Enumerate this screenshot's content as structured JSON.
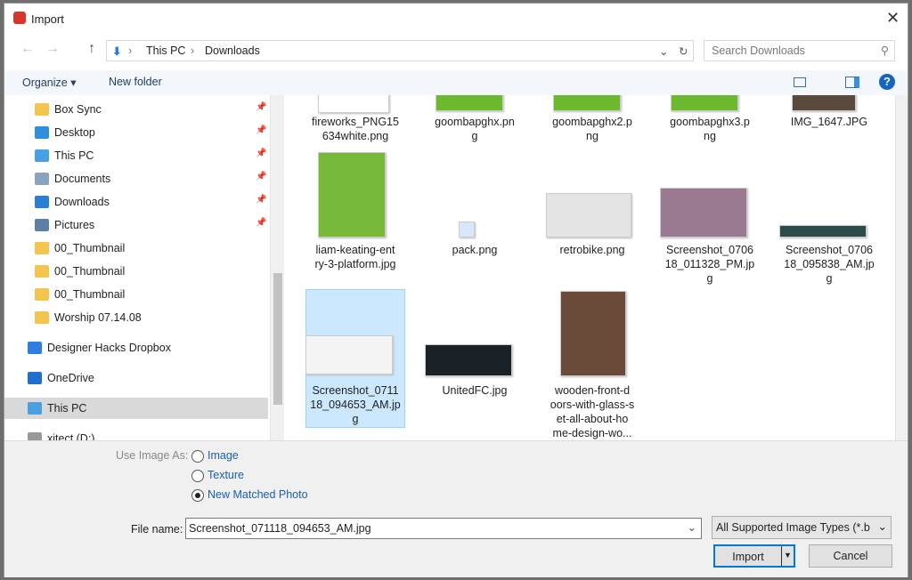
{
  "window": {
    "title": "Import",
    "close": "✕"
  },
  "address": {
    "back": "←",
    "forward": "→",
    "up": "↑",
    "path": [
      "This PC",
      "Downloads"
    ],
    "search_placeholder": "Search Downloads"
  },
  "toolbar": {
    "organize": "Organize ▾",
    "new_folder": "New folder",
    "help": "?"
  },
  "sidebar": {
    "items": [
      {
        "label": "Box Sync",
        "icon": "folder-icon",
        "color": "#f3c44e",
        "pinned": true
      },
      {
        "label": "Desktop",
        "icon": "desktop-icon",
        "color": "#2f8fdc",
        "pinned": true
      },
      {
        "label": "This PC",
        "icon": "computer-icon",
        "color": "#4a9fe0",
        "pinned": true
      },
      {
        "label": "Documents",
        "icon": "documents-icon",
        "color": "#8aa4c0",
        "pinned": true
      },
      {
        "label": "Downloads",
        "icon": "download-icon",
        "color": "#2a7fd4",
        "pinned": true
      },
      {
        "label": "Pictures",
        "icon": "pictures-icon",
        "color": "#5d7fa3",
        "pinned": true
      },
      {
        "label": "00_Thumbnail",
        "icon": "folder-icon",
        "color": "#f3c44e"
      },
      {
        "label": "00_Thumbnail",
        "icon": "folder-icon",
        "color": "#f3c44e"
      },
      {
        "label": "00_Thumbnail",
        "icon": "folder-icon",
        "color": "#f3c44e"
      },
      {
        "label": "Worship 07.14.08",
        "icon": "folder-icon",
        "color": "#f3c44e"
      },
      {
        "label": "Designer Hacks Dropbox",
        "icon": "dropbox-icon",
        "color": "#2f7de0"
      },
      {
        "label": "OneDrive",
        "icon": "onedrive-icon",
        "color": "#1f6fd0"
      },
      {
        "label": "This PC",
        "icon": "computer-icon",
        "color": "#4a9fe0",
        "selected": true
      },
      {
        "label": "xitect (D:)",
        "icon": "drive-icon",
        "color": "#999"
      }
    ]
  },
  "files": [
    {
      "name": "fireworks_PNG15\n634white.png",
      "thumb": "#ffffff"
    },
    {
      "name": "goombapghx.pn\ng",
      "thumb": "#6cb82f"
    },
    {
      "name": "goombapghx2.p\nng",
      "thumb": "#6cb82f"
    },
    {
      "name": "goombapghx3.p\nng",
      "thumb": "#6cb82f"
    },
    {
      "name": "IMG_1647.JPG",
      "thumb": "#5a4a3c"
    },
    {
      "name": "liam-keating-ent\nry-3-platform.jpg",
      "thumb": "#76b83a"
    },
    {
      "name": "pack.png",
      "thumb": "#d6e8fa"
    },
    {
      "name": "retrobike.png",
      "thumb": "#e4e4e4"
    },
    {
      "name": "Screenshot_0706\n18_011328_PM.jp\ng",
      "thumb": "#9a7a90"
    },
    {
      "name": "Screenshot_0706\n18_095838_AM.jp\ng",
      "thumb": "#2b4a4a"
    },
    {
      "name": "Screenshot_0711\n18_094653_AM.jp\ng",
      "thumb": "#f4f4f4",
      "selected": true
    },
    {
      "name": "UnitedFC.jpg",
      "thumb": "#1a2228"
    },
    {
      "name": "wooden-front-d\noors-with-glass-s\net-all-about-ho\nme-design-wo...",
      "thumb": "#6a4a38"
    }
  ],
  "options": {
    "label": "Use Image As:",
    "choices": [
      "Image",
      "Texture",
      "New Matched Photo"
    ],
    "selected": 2
  },
  "filename": {
    "label": "File name:",
    "value": "Screenshot_071118_094653_AM.jpg"
  },
  "filetype": {
    "value": "All Supported Image Types (*.b"
  },
  "buttons": {
    "import": "Import",
    "cancel": "Cancel"
  },
  "colors": {
    "selection": "#cce8ff",
    "link": "#1a5fb4"
  }
}
